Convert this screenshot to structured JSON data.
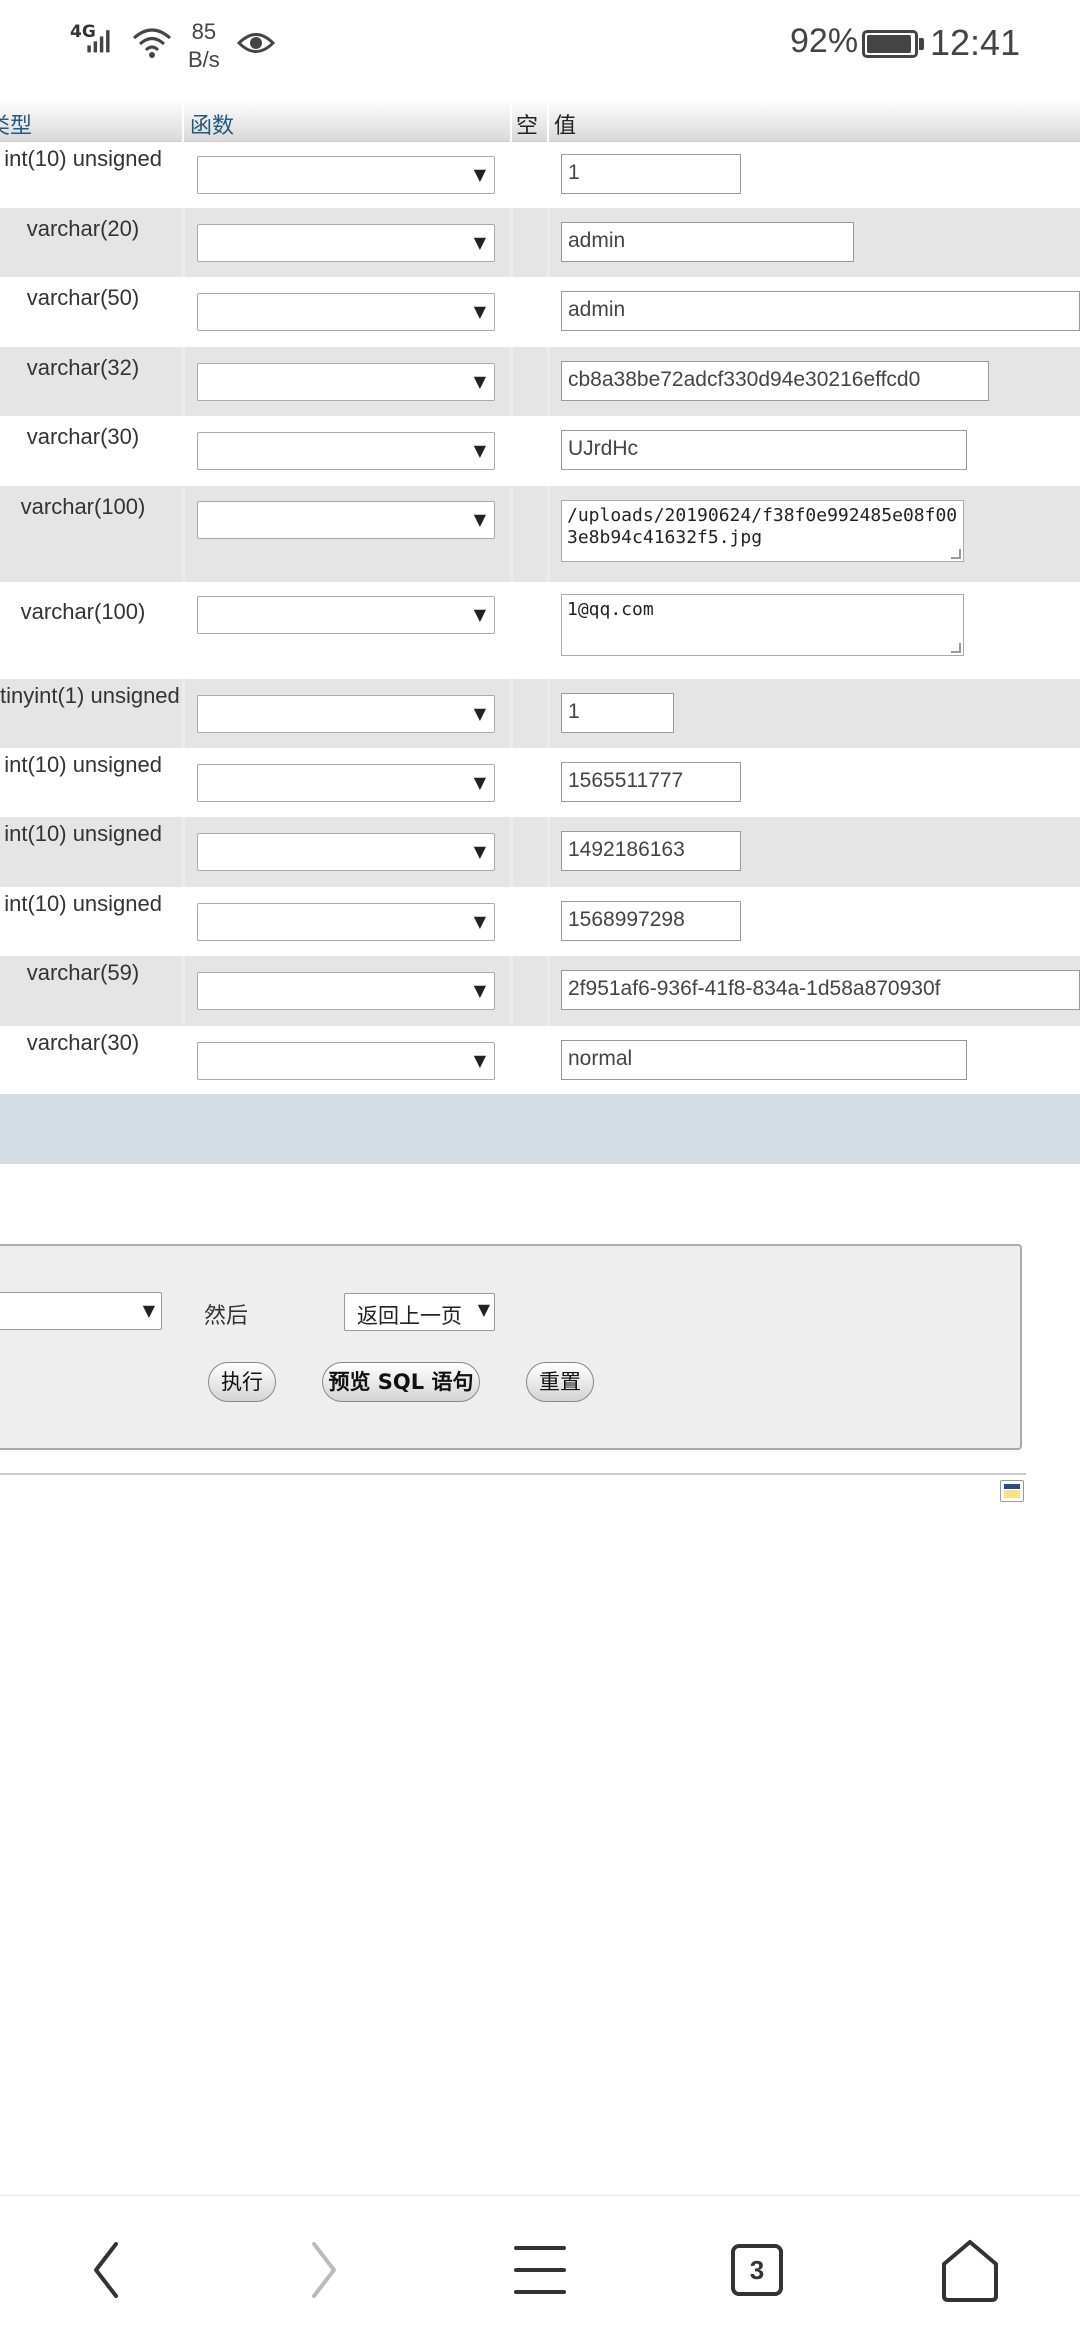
{
  "status_bar": {
    "network": "4G",
    "speed_value": "85",
    "speed_unit": "B/s",
    "battery": "92%",
    "time": "12:41"
  },
  "table": {
    "headers": {
      "type": "类型",
      "function": "函数",
      "null": "空",
      "value": "值"
    },
    "rows": [
      {
        "type": "int(10) unsigned",
        "value": "1",
        "kind": "input"
      },
      {
        "type": "varchar(20)",
        "value": "admin",
        "kind": "input"
      },
      {
        "type": "varchar(50)",
        "value": "admin",
        "kind": "input"
      },
      {
        "type": "varchar(32)",
        "value": "cb8a38be72adcf330d94e30216effcd0",
        "kind": "input"
      },
      {
        "type": "varchar(30)",
        "value": "UJrdHc",
        "kind": "input"
      },
      {
        "type": "varchar(100)",
        "value": "/uploads/20190624/f38f0e992485e08f003e8b94c41632f5.jpg",
        "kind": "textarea"
      },
      {
        "type": "varchar(100)",
        "value": "1@qq.com",
        "kind": "textarea"
      },
      {
        "type": "tinyint(1) unsigned",
        "value": "1",
        "kind": "input"
      },
      {
        "type": "int(10) unsigned",
        "value": "1565511777",
        "kind": "input"
      },
      {
        "type": "int(10) unsigned",
        "value": "1492186163",
        "kind": "input"
      },
      {
        "type": "int(10) unsigned",
        "value": "1568997298",
        "kind": "input"
      },
      {
        "type": "varchar(59)",
        "value": "2f951af6-936f-41f8-834a-1d58a870930f",
        "kind": "input"
      },
      {
        "type": "varchar(30)",
        "value": "normal",
        "kind": "input"
      }
    ]
  },
  "form_actions": {
    "then_label": "然后",
    "then_select": "返回上一页",
    "execute": "执行",
    "preview_sql": "预览 SQL 语句",
    "reset": "重置"
  },
  "browser_nav": {
    "tab_count": "3"
  },
  "icons": {
    "dropdown_arrow": "▼"
  }
}
